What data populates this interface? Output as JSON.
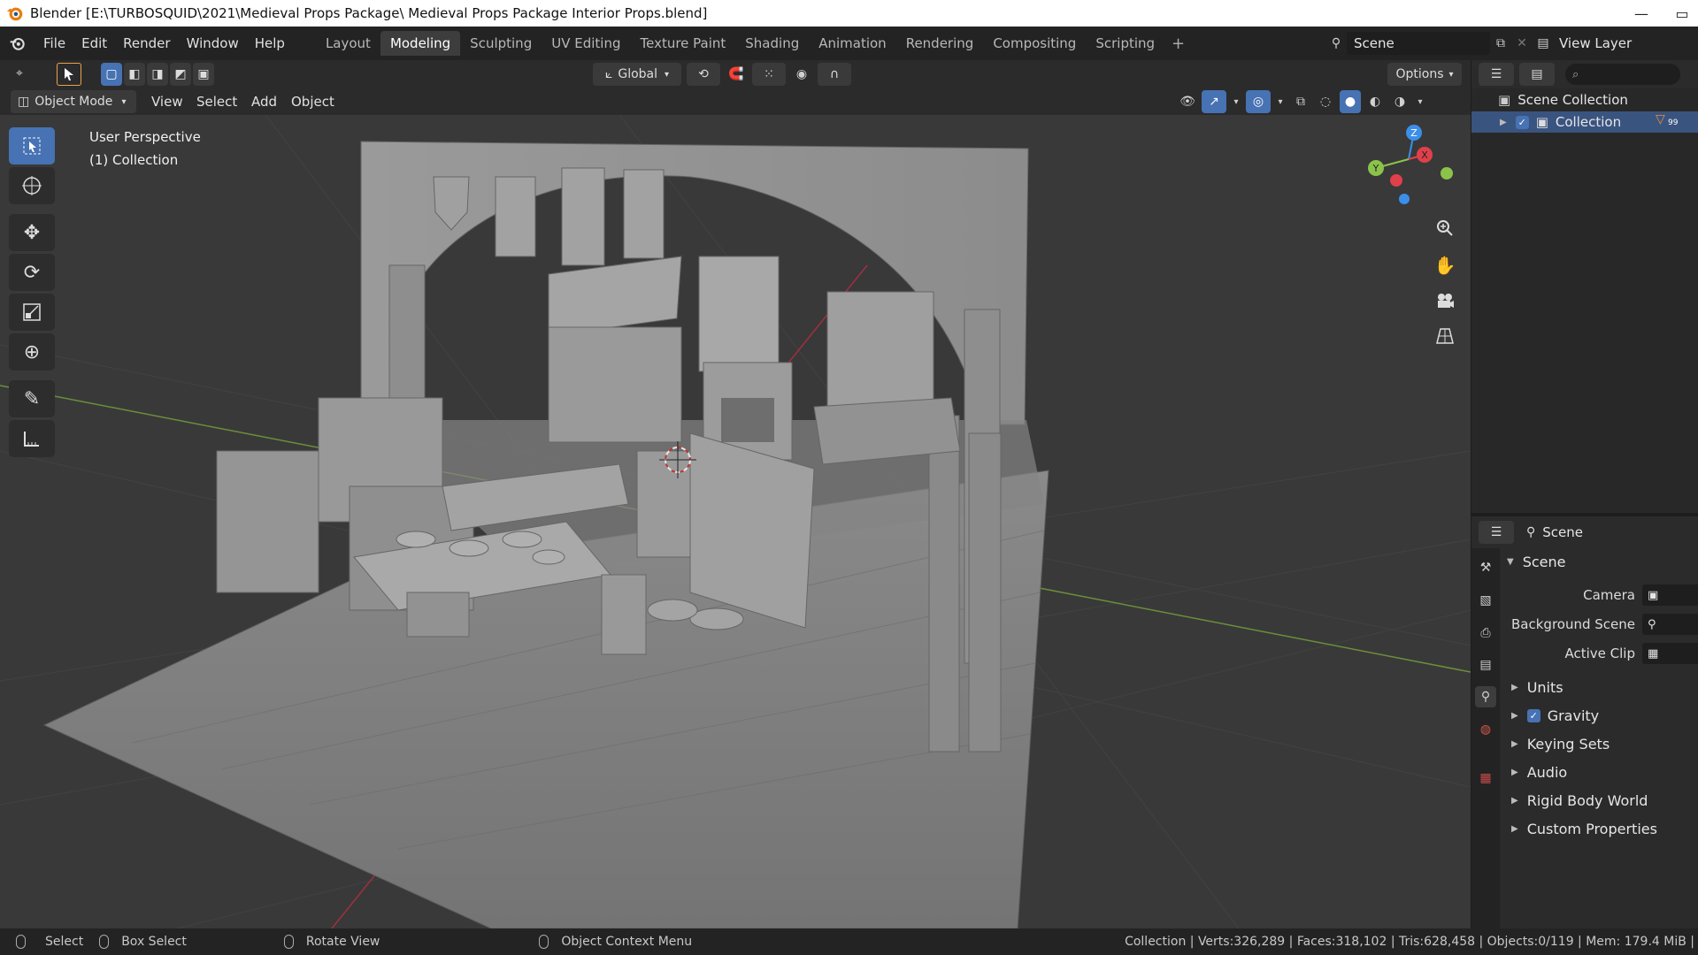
{
  "window": {
    "title": "Blender [E:\\TURBOSQUID\\2021\\Medieval Props Package\\ Medieval Props Package Interior Props.blend]",
    "minimize": "—",
    "maximize": "▭"
  },
  "menu": {
    "items": [
      "File",
      "Edit",
      "Render",
      "Window",
      "Help"
    ],
    "workspaces": [
      "Layout",
      "Modeling",
      "Sculpting",
      "UV Editing",
      "Texture Paint",
      "Shading",
      "Animation",
      "Rendering",
      "Compositing",
      "Scripting"
    ],
    "active_workspace": "Modeling",
    "add": "+",
    "scene_name": "Scene",
    "view_layer": "View Layer"
  },
  "tool_header": {
    "transform_orientation": "Global",
    "options": "Options"
  },
  "viewport_header": {
    "mode": "Object Mode",
    "menus": [
      "View",
      "Select",
      "Add",
      "Object"
    ]
  },
  "viewport": {
    "perspective_label": "User Perspective",
    "collection_label": "(1) Collection",
    "gizmo_axes": {
      "z": "Z",
      "y": "Y",
      "x": "X"
    }
  },
  "outliner": {
    "root": "Scene Collection",
    "collection": "Collection",
    "filter_badge": "99"
  },
  "properties": {
    "header": "Scene",
    "section": "Scene",
    "fields": [
      {
        "label": "Camera"
      },
      {
        "label": "Background Scene"
      },
      {
        "label": "Active Clip"
      }
    ],
    "panels": [
      "Units",
      "Gravity",
      "Keying Sets",
      "Audio",
      "Rigid Body World",
      "Custom Properties"
    ],
    "gravity_checked": true
  },
  "statusbar": {
    "select": "Select",
    "box_select": "Box Select",
    "rotate_view": "Rotate View",
    "context_menu": "Object Context Menu",
    "stats": "Collection | Verts:326,289 | Faces:318,102 | Tris:628,458 | Objects:0/119 | Mem: 179.4 MiB |"
  },
  "colors": {
    "accent": "#4772b3",
    "viewport_bg": "#393939",
    "axis_x": "#e0404a",
    "axis_y": "#8bc34a",
    "axis_z": "#3b8fe8"
  }
}
